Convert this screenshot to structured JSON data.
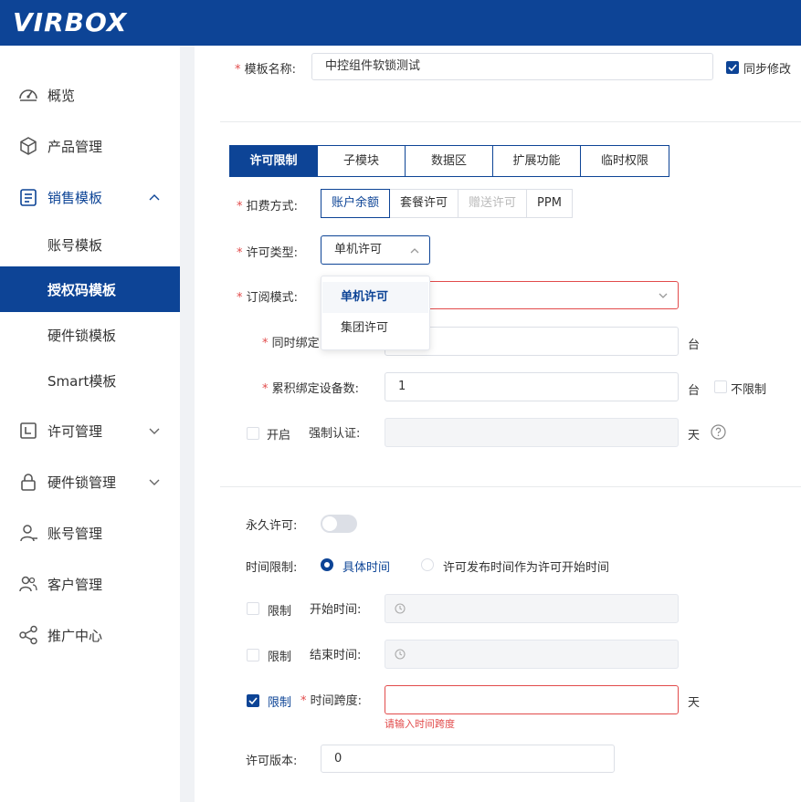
{
  "brand": {
    "logo_text": "VIRBOX"
  },
  "sidebar": {
    "items": [
      {
        "label": "概览",
        "icon": "dashboard-icon"
      },
      {
        "label": "产品管理",
        "icon": "cube-icon"
      },
      {
        "label": "销售模板",
        "icon": "template-icon",
        "expanded": true
      },
      {
        "label": "账号模板"
      },
      {
        "label": "授权码模板",
        "active": true
      },
      {
        "label": "硬件锁模板"
      },
      {
        "label": "Smart模板"
      },
      {
        "label": "许可管理",
        "icon": "license-icon"
      },
      {
        "label": "硬件锁管理",
        "icon": "lock-icon"
      },
      {
        "label": "账号管理",
        "icon": "user-icon"
      },
      {
        "label": "客户管理",
        "icon": "users-icon"
      },
      {
        "label": "推广中心",
        "icon": "share-icon"
      }
    ]
  },
  "form": {
    "template_name_label": "模板名称:",
    "template_name_value": "中控组件软锁测试",
    "sync_label": "同步修改",
    "tabs": [
      "许可限制",
      "子模块",
      "数据区",
      "扩展功能",
      "临时权限"
    ],
    "billing": {
      "label": "扣费方式:",
      "options": [
        "账户余额",
        "套餐许可",
        "赠送许可",
        "PPM"
      ],
      "selected": "账户余额"
    },
    "license_type": {
      "label": "许可类型:",
      "value": "单机许可",
      "options": [
        "单机许可",
        "集团许可"
      ]
    },
    "subscription": {
      "label": "订阅模式:"
    },
    "concurrent_bind": {
      "label": "同时绑定",
      "unit": "台"
    },
    "cumulative_bind": {
      "label": "累积绑定设备数:",
      "value": "1",
      "unit": "台",
      "unlimited_label": "不限制"
    },
    "force_auth": {
      "enable_label": "开启",
      "label": "强制认证:",
      "unit": "天"
    },
    "permanent": {
      "label": "永久许可:",
      "on": false
    },
    "time_limit": {
      "label": "时间限制:",
      "options": [
        "具体时间",
        "许可发布时间作为许可开始时间"
      ],
      "selected": "具体时间"
    },
    "start_time": {
      "limit_label": "限制",
      "label": "开始时间:"
    },
    "end_time": {
      "limit_label": "限制",
      "label": "结束时间:"
    },
    "time_span": {
      "limit_label": "限制",
      "label": "时间跨度:",
      "unit": "天",
      "error": "请输入时间跨度"
    },
    "version": {
      "label": "许可版本:",
      "value": "0"
    }
  },
  "colors": {
    "primary": "#0d4496",
    "error": "#e24b4b"
  }
}
